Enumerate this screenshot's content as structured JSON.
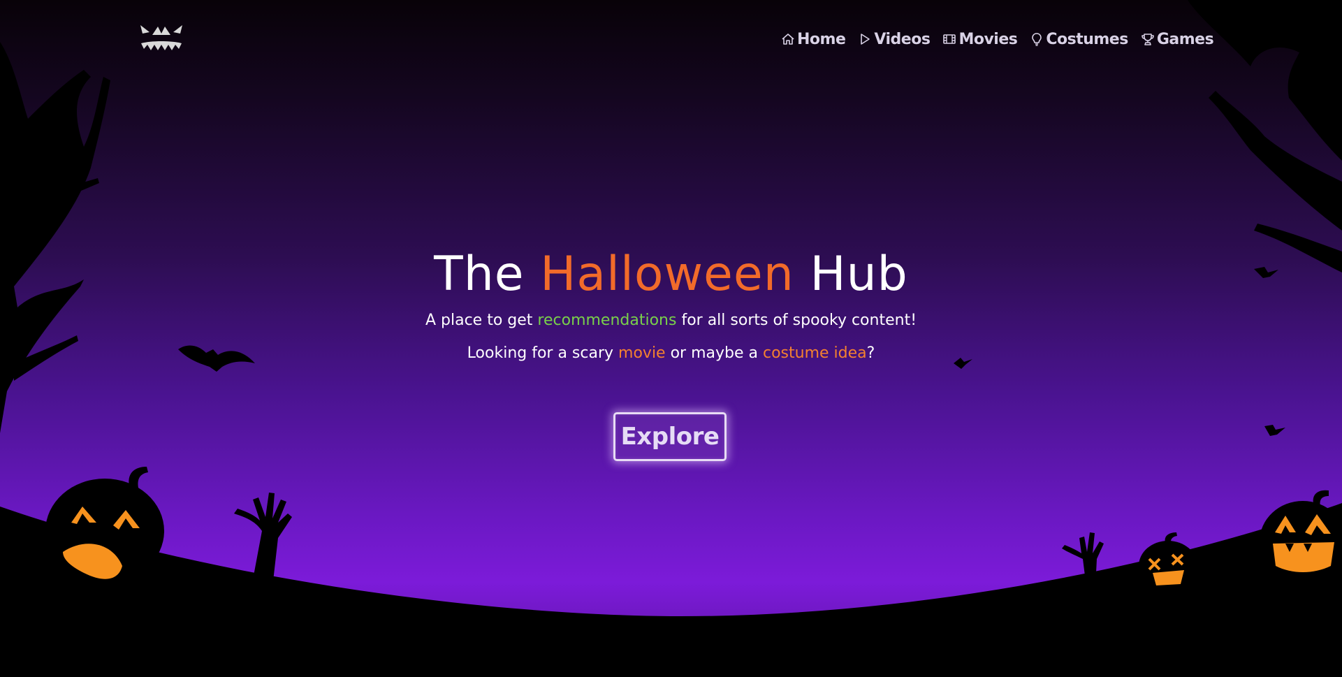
{
  "nav": {
    "items": [
      {
        "label": "Home",
        "icon": "home-icon"
      },
      {
        "label": "Videos",
        "icon": "play-icon"
      },
      {
        "label": "Movies",
        "icon": "film-icon"
      },
      {
        "label": "Costumes",
        "icon": "lightbulb-icon"
      },
      {
        "label": "Games",
        "icon": "trophy-icon"
      }
    ]
  },
  "hero": {
    "title_prefix": "The ",
    "title_highlight": "Halloween",
    "title_suffix": " Hub",
    "line1_prefix": "A place to get ",
    "line1_highlight": "recommendations",
    "line1_suffix": " for all sorts of spooky content!",
    "line2_prefix": "Looking for a scary ",
    "line2_link1": "movie",
    "line2_middle": " or maybe a ",
    "line2_link2": "costume idea",
    "line2_suffix": "?",
    "button_label": "Explore"
  },
  "colors": {
    "accent_orange": "#f26b2a",
    "accent_green": "#79d04a",
    "nav_text": "#d9d2e6",
    "sky_top": "#080208",
    "sky_bottom": "#7c1bd9"
  }
}
